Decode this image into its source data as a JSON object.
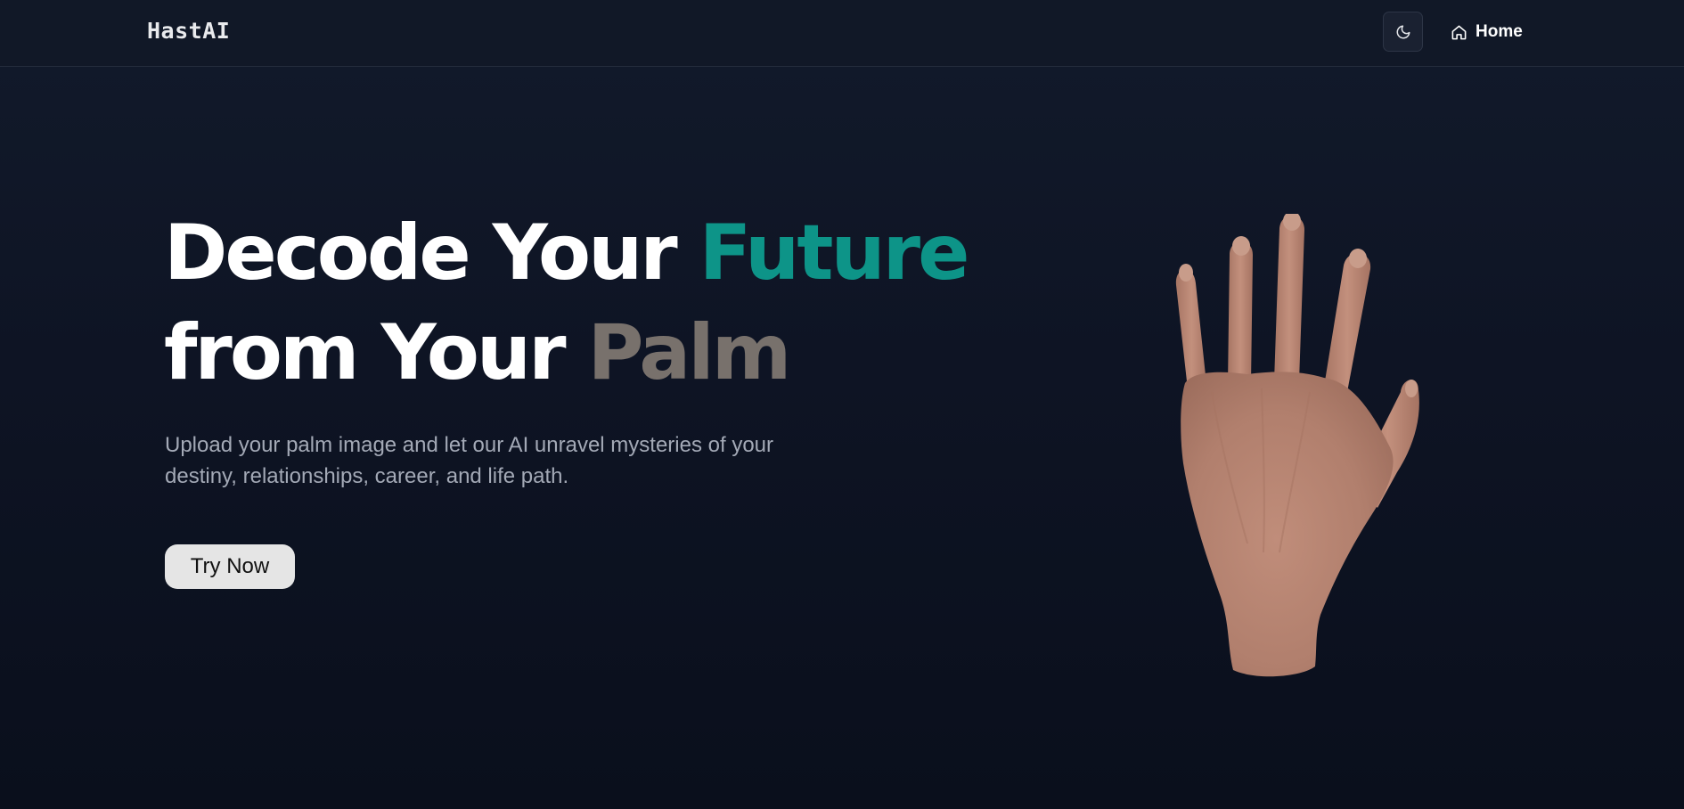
{
  "header": {
    "logo": "HastAI",
    "theme_toggle_icon": "moon-icon",
    "nav": {
      "home_icon": "home-icon",
      "home_label": "Home"
    }
  },
  "hero": {
    "title_line1_part1": "Decode Your ",
    "title_line1_accent": "Future",
    "title_line2_part1": "from Your ",
    "title_line2_accent": "Palm",
    "subtitle": "Upload your palm image and let our AI unravel mysteries of your destiny, relationships, career, and life path.",
    "cta_label": "Try Now",
    "image": "hand-illustration"
  },
  "colors": {
    "background": "#0e1424",
    "accent_teal": "#0d9488",
    "accent_gray": "#78716c",
    "button_bg": "#e5e5e5"
  }
}
